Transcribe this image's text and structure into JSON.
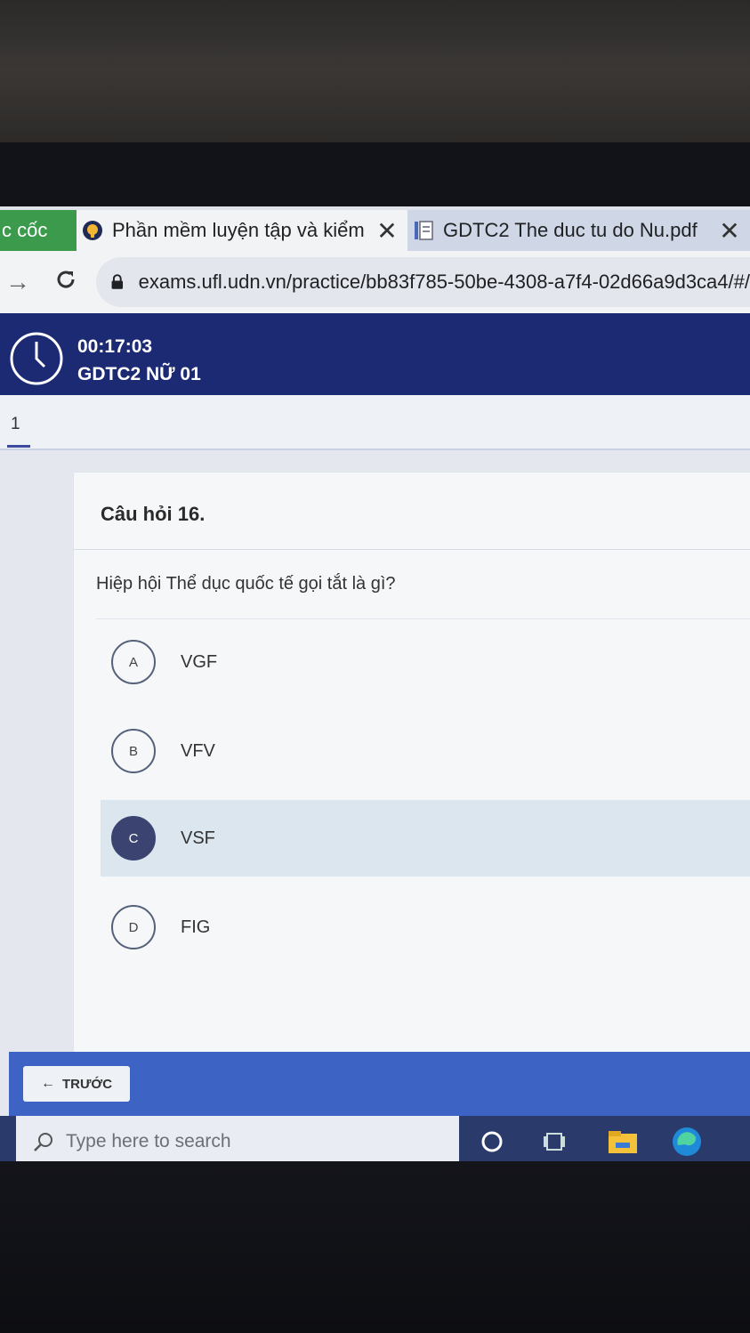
{
  "browser": {
    "tabs": [
      {
        "title": "c cốc"
      },
      {
        "title": "Phần mềm luyện tập và kiểm",
        "close": "✕"
      },
      {
        "title": "GDTC2 The duc tu do Nu.pdf",
        "close": "✕"
      }
    ],
    "url": "exams.ufl.udn.vn/practice/bb83f785-50be-4308-a7f4-02d66a9d3ca4/#/"
  },
  "exam": {
    "timer": "00:17:03",
    "name": "GDTC2 NỮ 01"
  },
  "pager": {
    "current": "1"
  },
  "question": {
    "title": "Câu hỏi 16.",
    "text": "Hiệp hội Thể dục quốc tế gọi tắt là gì?",
    "options": [
      {
        "letter": "A",
        "text": "VGF",
        "selected": false
      },
      {
        "letter": "B",
        "text": "VFV",
        "selected": false
      },
      {
        "letter": "C",
        "text": "VSF",
        "selected": true
      },
      {
        "letter": "D",
        "text": "FIG",
        "selected": false
      }
    ]
  },
  "navigation": {
    "prev_label": "TRƯỚC"
  },
  "taskbar": {
    "search_placeholder": "Type here to search"
  },
  "colors": {
    "header_bg": "#1b2a72",
    "nav_bar": "#3d63c4",
    "selected_option": "#dbe6ef",
    "selected_circle": "#3b4470"
  }
}
